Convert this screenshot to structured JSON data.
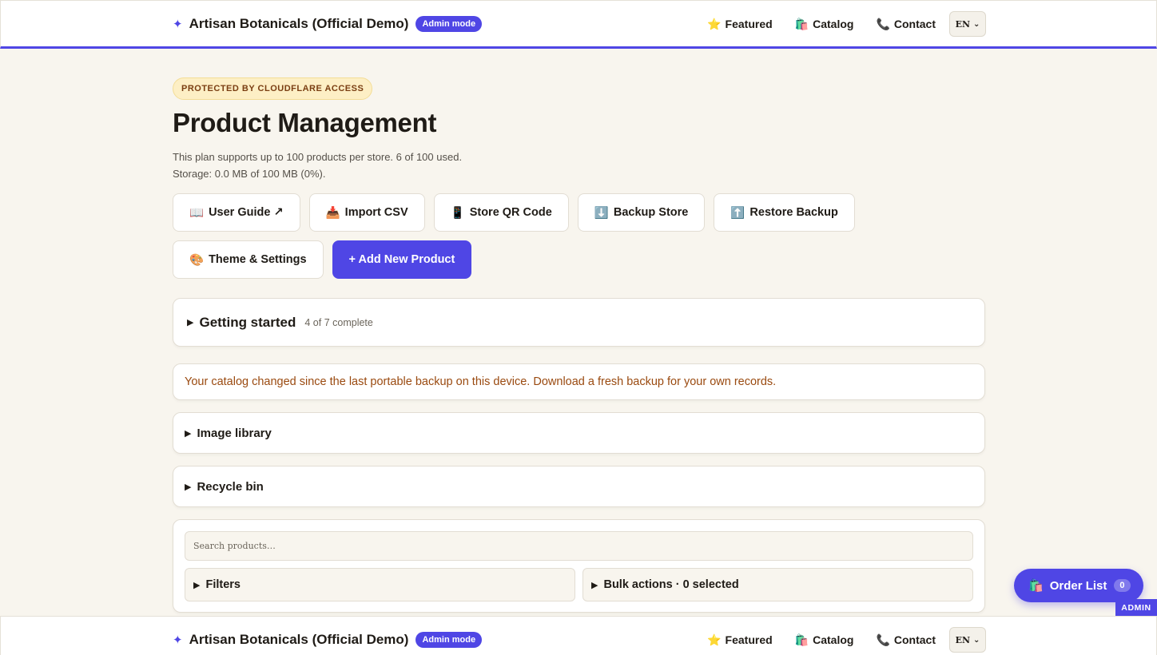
{
  "header": {
    "brand_icon": "sparkle-icon",
    "brand_name": "Artisan Botanicals (Official Demo)",
    "admin_badge": "Admin mode",
    "nav": [
      {
        "icon": "⭐",
        "label": "Featured"
      },
      {
        "icon": "🛍️",
        "label": "Catalog"
      },
      {
        "icon": "📞",
        "label": "Contact"
      }
    ],
    "language": "EN"
  },
  "main": {
    "protected_label": "PROTECTED BY CLOUDFLARE ACCESS",
    "title": "Product Management",
    "plan_text": "This plan supports up to 100 products per store. 6 of 100 used.",
    "storage_text": "Storage: 0.0 MB of 100 MB (0%).",
    "actions": [
      {
        "icon": "📖",
        "label": "User Guide ↗"
      },
      {
        "icon": "📥",
        "label": "Import CSV"
      },
      {
        "icon": "📱",
        "label": "Store QR Code"
      },
      {
        "icon": "⬇️",
        "label": "Backup Store"
      },
      {
        "icon": "⬆️",
        "label": "Restore Backup"
      },
      {
        "icon": "🎨",
        "label": "Theme & Settings"
      },
      {
        "icon": "",
        "label": "+ Add New Product"
      }
    ]
  },
  "getting_started": {
    "title": "Getting started",
    "progress": "4 of 7 complete"
  },
  "backup_notice": "Your catalog changed since the last portable backup on this device. Download a fresh backup for your own records.",
  "image_library": {
    "title": "Image library"
  },
  "recycle_bin": {
    "title": "Recycle bin"
  },
  "search": {
    "placeholder": "Search products…",
    "filters_label": "Filters",
    "bulk_label": "Bulk actions · 0 selected"
  },
  "order_list": {
    "icon": "🛍️",
    "label": "Order List",
    "count": "0"
  },
  "admin_tag": "ADMIN",
  "colors": {
    "accent": "#4f46e5",
    "background": "#f8f5ee",
    "notice_text": "#9a4a10",
    "protected_bg": "#fdefc5"
  }
}
